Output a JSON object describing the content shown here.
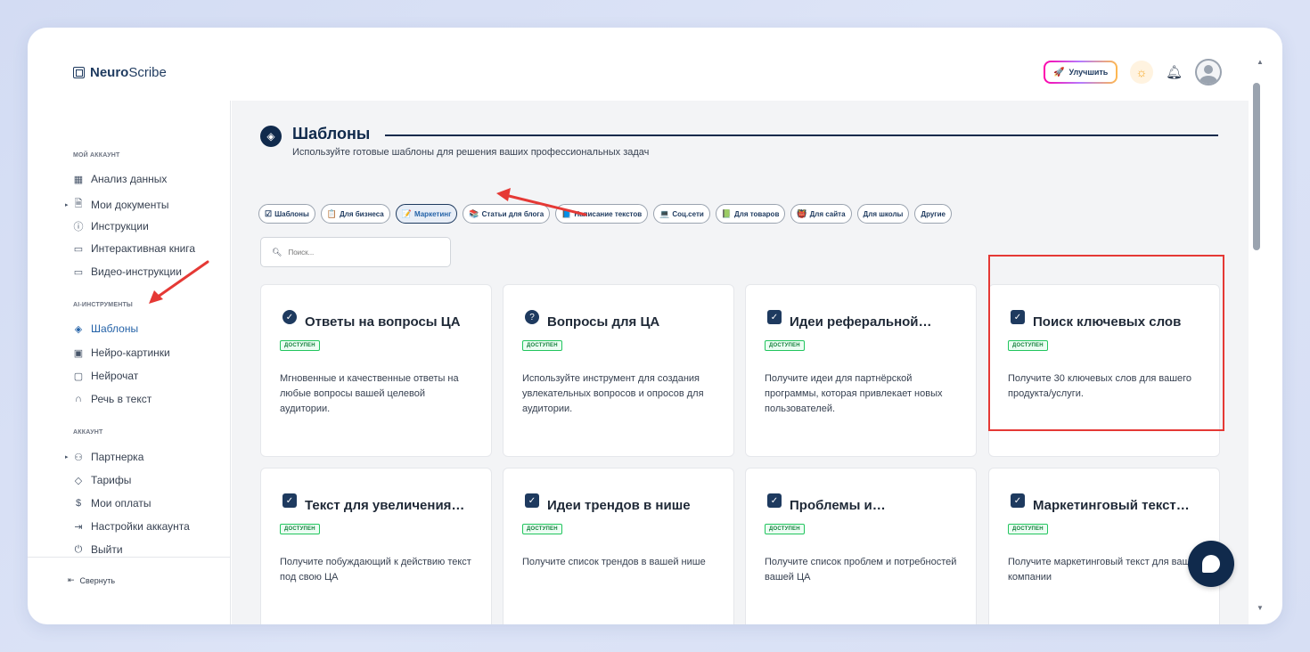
{
  "app": {
    "logo_bold": "Neuro",
    "logo_rest": "Scribe"
  },
  "header": {
    "upgrade_label": "Улучшить"
  },
  "sidebar": {
    "sections": [
      {
        "title": "МОЙ АККАУНТ"
      },
      {
        "title": "AI-ИНСТРУМЕНТЫ"
      },
      {
        "title": "АККАУНТ"
      }
    ],
    "items": [
      {
        "label": "Анализ данных",
        "icon": "grid-icon"
      },
      {
        "label": "Мои документы",
        "icon": "document-icon"
      },
      {
        "label": "Инструкции",
        "icon": "help-circle-icon"
      },
      {
        "label": "Интерактивная книга",
        "icon": "book-icon"
      },
      {
        "label": "Видео-инструкции",
        "icon": "video-icon"
      },
      {
        "label": "Шаблоны",
        "icon": "layers-icon"
      },
      {
        "label": "Нейро-картинки",
        "icon": "image-icon"
      },
      {
        "label": "Нейрочат",
        "icon": "chat-icon"
      },
      {
        "label": "Речь в текст",
        "icon": "headphones-icon"
      },
      {
        "label": "Партнерка",
        "icon": "users-icon"
      },
      {
        "label": "Тарифы",
        "icon": "tag-icon"
      },
      {
        "label": "Мои оплаты",
        "icon": "dollar-icon"
      },
      {
        "label": "Настройки аккаунта",
        "icon": "login-icon"
      },
      {
        "label": "Выйти",
        "icon": "power-icon"
      }
    ],
    "collapse_label": "Свернуть"
  },
  "main": {
    "title": "Шаблоны",
    "subtitle": "Используйте готовые шаблоны для решения ваших профессиональных задач",
    "chips": [
      {
        "label": "Шаблоны",
        "emoji": "☑"
      },
      {
        "label": "Для бизнеса",
        "emoji": "📋"
      },
      {
        "label": "Маркетинг",
        "emoji": "📝"
      },
      {
        "label": "Статьи для блога",
        "emoji": "📚"
      },
      {
        "label": "Написание текстов",
        "emoji": "📘"
      },
      {
        "label": "Соц.сети",
        "emoji": "💻"
      },
      {
        "label": "Для товаров",
        "emoji": "📗"
      },
      {
        "label": "Для сайта",
        "emoji": "👹"
      },
      {
        "label": "Для школы",
        "emoji": ""
      },
      {
        "label": "Другие",
        "emoji": ""
      }
    ],
    "active_chip": "Маркетинг",
    "search_placeholder": "Поиск...",
    "badge": "ДОСТУПЕН",
    "cards": [
      {
        "title": "Ответы на вопросы ЦА",
        "desc": "Мгновенные и качественные ответы на любые вопросы вашей целевой аудитории."
      },
      {
        "title": "Вопросы для ЦА",
        "desc": "Используйте инструмент для создания увлекательных вопросов и опросов для аудитории."
      },
      {
        "title": "Идеи реферальной…",
        "desc": "Получите идеи для партнёрской программы, которая привлекает новых пользователей."
      },
      {
        "title": "Поиск ключевых слов",
        "desc": "Получите 30 ключевых слов для вашего продукта/услуги."
      },
      {
        "title": "Текст для увеличения…",
        "desc": "Получите побуждающий к действию текст под свою ЦА"
      },
      {
        "title": "Идеи трендов в нише",
        "desc": "Получите список трендов в вашей нише"
      },
      {
        "title": "Проблемы и…",
        "desc": "Получите список проблем и потребностей вашей ЦА"
      },
      {
        "title": "Маркетинговый текст…",
        "desc": "Получите маркетинговый текст для вашей компании"
      }
    ]
  },
  "colors": {
    "accent": "#102a4c",
    "highlight": "#e53935",
    "badge_green": "#22c55e"
  }
}
